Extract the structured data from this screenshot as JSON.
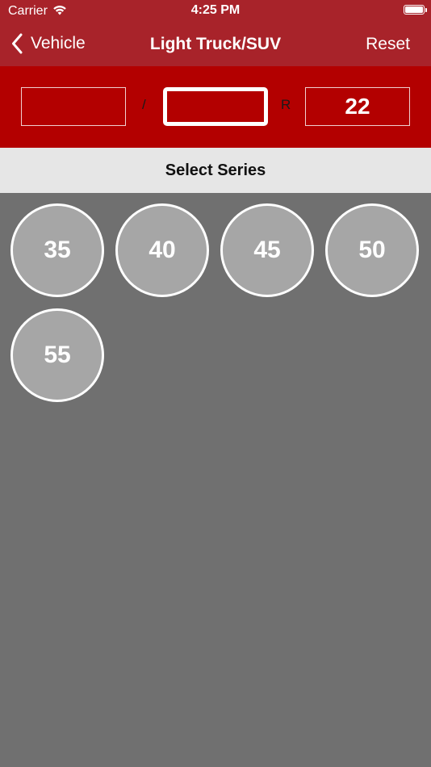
{
  "status_bar": {
    "carrier": "Carrier",
    "time": "4:25 PM",
    "wifi_icon": "wifi-icon",
    "battery_icon": "battery-icon"
  },
  "nav": {
    "back_label": "Vehicle",
    "back_icon": "chevron-left-icon",
    "title": "Light Truck/SUV",
    "reset_label": "Reset"
  },
  "tire_size": {
    "width_value": "",
    "slash": "/",
    "series_value": "",
    "rim_prefix": "R",
    "rim_value": "22"
  },
  "section": {
    "header": "Select Series"
  },
  "series_options": [
    "35",
    "40",
    "45",
    "50",
    "55"
  ],
  "colors": {
    "nav_background": "#a8232a",
    "size_bar_background": "#b30000",
    "section_header_background": "#e6e6e6",
    "content_background": "#707070",
    "option_fill": "#a6a6a6",
    "option_border": "#ffffff"
  }
}
